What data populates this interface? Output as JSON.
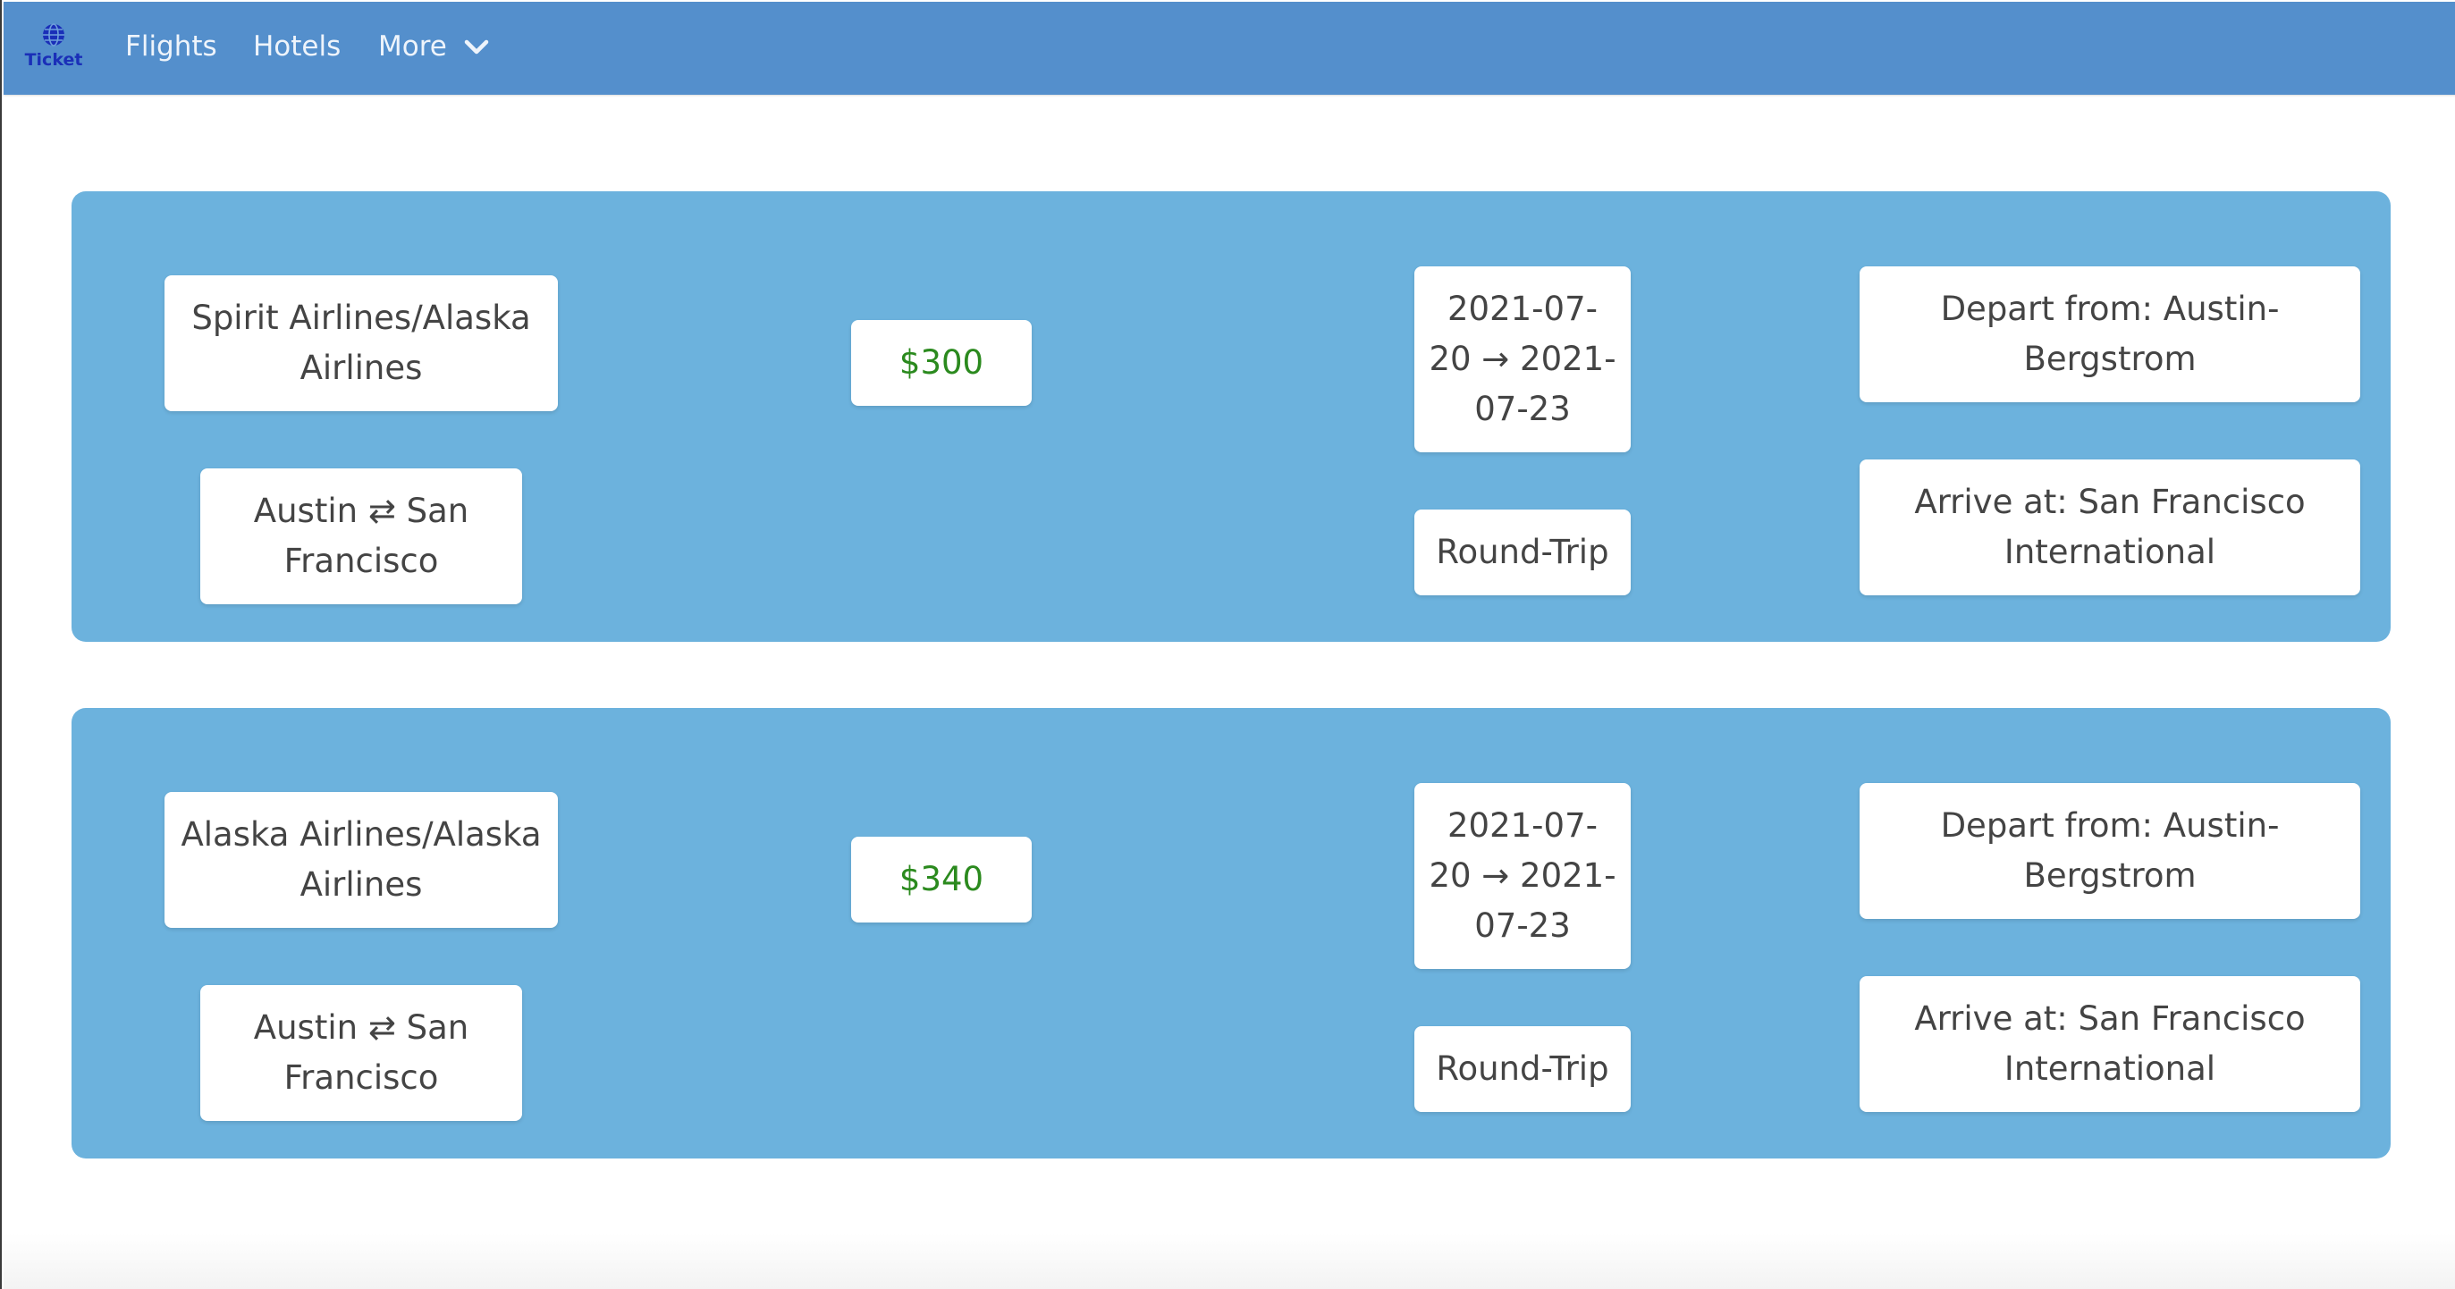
{
  "navbar": {
    "brand": "Ticket",
    "links": {
      "flights": "Flights",
      "hotels": "Hotels",
      "more": "More"
    }
  },
  "colors": {
    "navbar": "#548fcc",
    "card": "#6cb2dd",
    "price": "#2b8a1e",
    "brand": "#1a2fb8"
  },
  "flights": [
    {
      "airline": "Spirit Airlines/Alaska Airlines",
      "route": "Austin ⇄ San Francisco",
      "price": "$300",
      "dates": "2021-07-20 → 2021-07-23",
      "trip_type": "Round-Trip",
      "depart": "Depart from: Austin-Bergstrom",
      "arrive": "Arrive at: San Francisco International"
    },
    {
      "airline": "Alaska Airlines/Alaska Airlines",
      "route": "Austin ⇄ San Francisco",
      "price": "$340",
      "dates": "2021-07-20 → 2021-07-23",
      "trip_type": "Round-Trip",
      "depart": "Depart from: Austin-Bergstrom",
      "arrive": "Arrive at: San Francisco International"
    }
  ]
}
